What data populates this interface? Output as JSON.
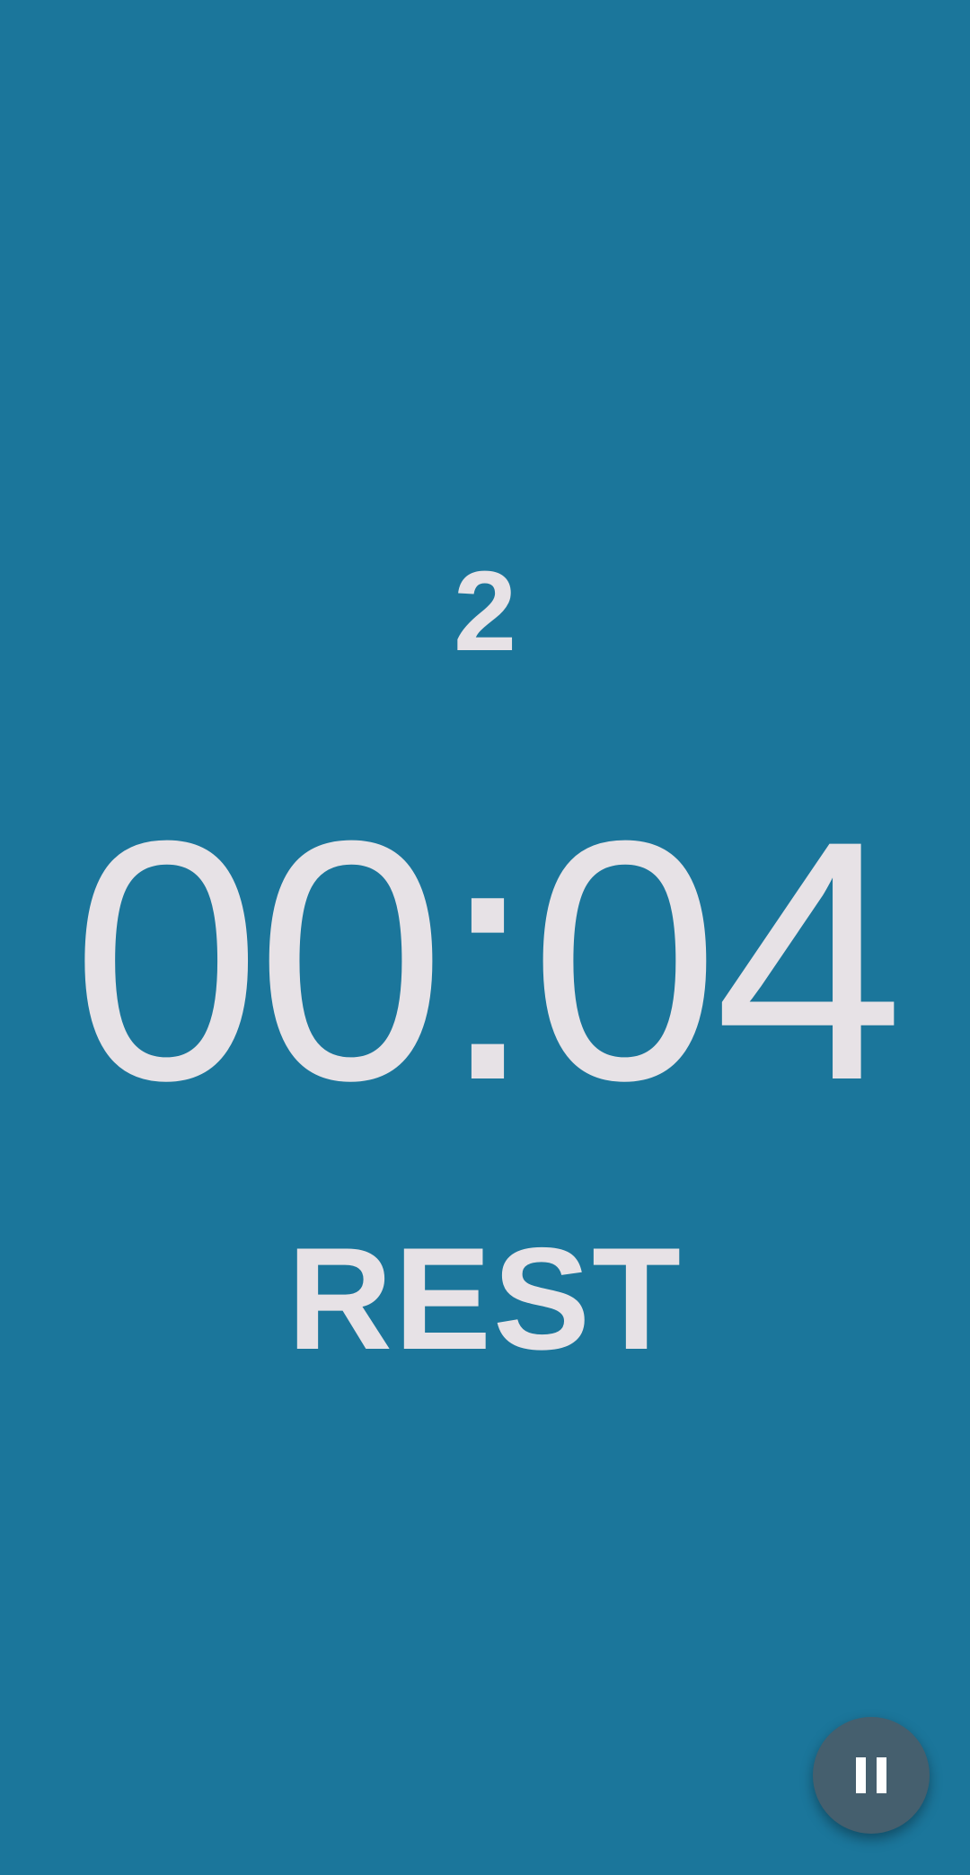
{
  "timer": {
    "round": "2",
    "time": "00:04",
    "phase": "REST"
  },
  "controls": {
    "pause_icon": "pause-icon"
  },
  "colors": {
    "background": "#1b769b",
    "text": "#e7e2e6",
    "fab": "#455f6e",
    "fab_icon": "#ffffff"
  }
}
